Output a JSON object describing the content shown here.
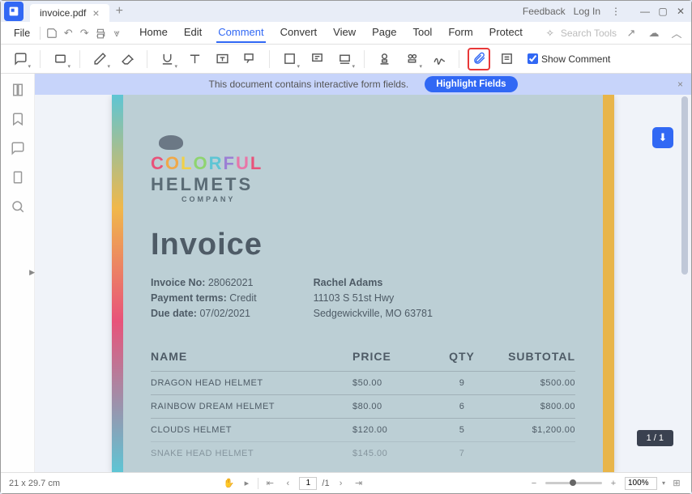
{
  "titlebar": {
    "tab_name": "invoice.pdf",
    "feedback": "Feedback",
    "login": "Log In"
  },
  "menubar": {
    "file": "File",
    "tabs": [
      "Home",
      "Edit",
      "Comment",
      "Convert",
      "View",
      "Page",
      "Tool",
      "Form",
      "Protect"
    ],
    "active_index": 2,
    "search_placeholder": "Search Tools"
  },
  "toolbar": {
    "show_comment": "Show Comment"
  },
  "banner": {
    "text": "This document contains interactive form fields.",
    "button": "Highlight Fields"
  },
  "document": {
    "logo_line1": "COLORFUL",
    "logo_line2": "HELMETS",
    "logo_line3": "COMPANY",
    "title": "Invoice",
    "invoice_no_label": "Invoice No:",
    "invoice_no": "28062021",
    "payment_terms_label": "Payment terms:",
    "payment_terms": "Credit",
    "due_date_label": "Due date:",
    "due_date": "07/02/2021",
    "customer_name": "Rachel Adams",
    "customer_addr1": "11103 S 51st Hwy",
    "customer_addr2": "Sedgewickville, MO 63781",
    "headers": {
      "name": "NAME",
      "price": "PRICE",
      "qty": "QTY",
      "subtotal": "SUBTOTAL"
    },
    "rows": [
      {
        "name": "DRAGON HEAD HELMET",
        "price": "$50.00",
        "qty": "9",
        "subtotal": "$500.00"
      },
      {
        "name": "RAINBOW DREAM HELMET",
        "price": "$80.00",
        "qty": "6",
        "subtotal": "$800.00"
      },
      {
        "name": "CLOUDS HELMET",
        "price": "$120.00",
        "qty": "5",
        "subtotal": "$1,200.00"
      },
      {
        "name": "SNAKE HEAD HELMET",
        "price": "$145.00",
        "qty": "7",
        "subtotal": ""
      }
    ]
  },
  "page_indicator": "1 / 1",
  "statusbar": {
    "dimensions": "21 x 29.7 cm",
    "page_current": "1",
    "page_total": "/1",
    "zoom": "100%"
  }
}
